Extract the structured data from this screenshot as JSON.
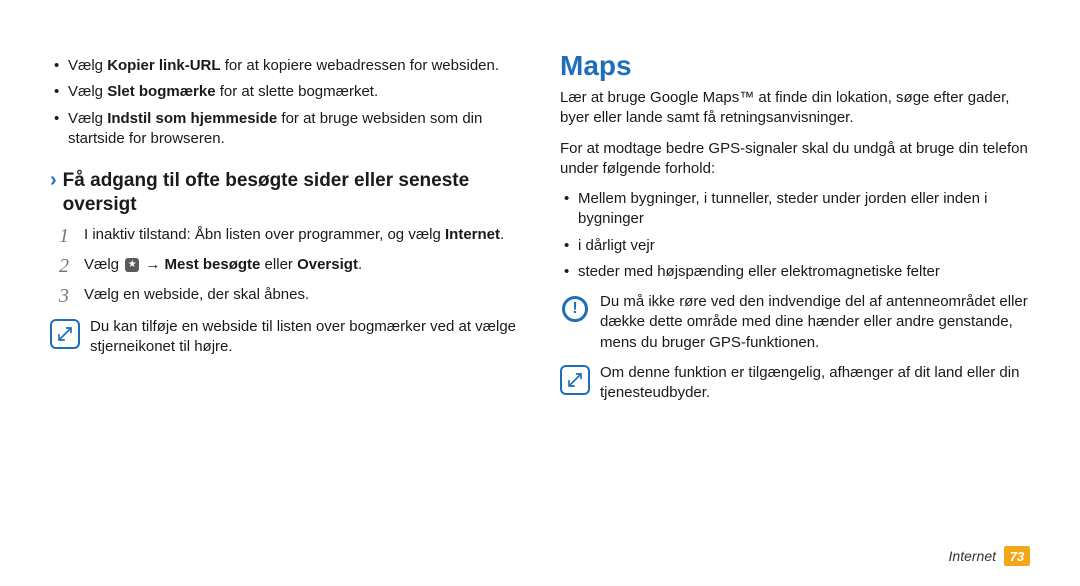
{
  "left": {
    "bullets": [
      {
        "prefix": "Vælg ",
        "bold": "Kopier link-URL",
        "suffix": " for at kopiere webadressen for websiden."
      },
      {
        "prefix": "Vælg ",
        "bold": "Slet bogmærke",
        "suffix": " for at slette bogmærket."
      },
      {
        "prefix": "Vælg ",
        "bold": "Indstil som hjemmeside",
        "suffix": " for at bruge websiden som din startside for browseren."
      }
    ],
    "subheading": "Få adgang til ofte besøgte sider eller seneste oversigt",
    "steps": [
      {
        "num": "1",
        "pre": "I inaktiv tilstand: Åbn listen over programmer, og vælg ",
        "bold": "Internet",
        "post": "."
      },
      {
        "num": "2",
        "pre": "Vælg ",
        "icon": "star",
        "mid1": " → ",
        "bold1": "Mest besøgte",
        "mid2": " eller ",
        "bold2": "Oversigt",
        "post": "."
      },
      {
        "num": "3",
        "pre": "Vælg en webside, der skal åbnes."
      }
    ],
    "note": "Du kan tilføje en webside til listen over bogmærker ved at vælge stjerneikonet til højre."
  },
  "right": {
    "title": "Maps",
    "intro1": "Lær at bruge Google Maps™ at finde din lokation, søge efter gader, byer eller lande samt få retningsanvisninger.",
    "intro2": "For at modtage bedre GPS-signaler skal du undgå at bruge din telefon under følgende forhold:",
    "bullets": [
      "Mellem bygninger, i tunneller, steder under jorden eller inden i bygninger",
      "i dårligt vejr",
      "steder med højspænding eller elektromagnetiske felter"
    ],
    "warning": "Du må ikke røre ved den indvendige del af antenneområdet eller dække dette område med dine hænder eller andre genstande, mens du bruger GPS-funktionen.",
    "note": "Om denne funktion er tilgængelig, afhænger af dit land eller din tjenesteudbyder."
  },
  "footer": {
    "section": "Internet",
    "page": "73"
  }
}
